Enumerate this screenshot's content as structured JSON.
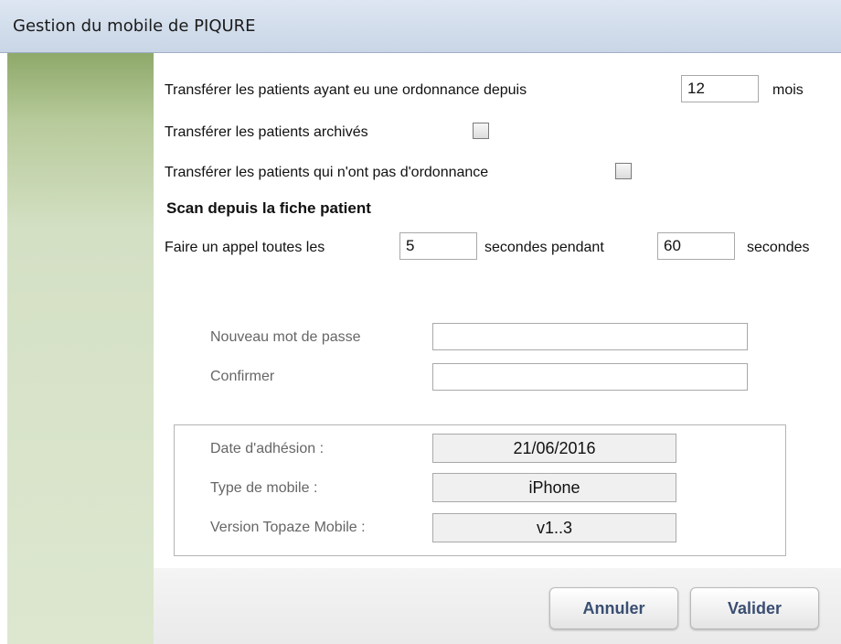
{
  "window": {
    "title": "Gestion du mobile de PIQURE"
  },
  "transfer": {
    "ordonnance_label": "Transférer les patients ayant eu une ordonnance depuis",
    "months_value": "12",
    "months_unit": "mois",
    "archived_label": "Transférer les patients archivés",
    "archived_checked": false,
    "no_ordonnance_label": "Transférer les patients qui n'ont pas d'ordonnance",
    "no_ordonnance_checked": false
  },
  "scan": {
    "heading": "Scan depuis la fiche patient",
    "call_label": "Faire un appel toutes les",
    "interval_value": "5",
    "during_label": "secondes pendant",
    "duration_value": "60",
    "seconds_label": "secondes"
  },
  "password": {
    "new_label": "Nouveau mot de passe",
    "new_value": "",
    "confirm_label": "Confirmer",
    "confirm_value": ""
  },
  "info": {
    "date_label": "Date d'adhésion :",
    "date_value": "21/06/2016",
    "type_label": "Type de mobile :",
    "type_value": "iPhone",
    "version_label": "Version Topaze Mobile :",
    "version_value": "v1..3"
  },
  "buttons": {
    "cancel": "Annuler",
    "submit": "Valider"
  },
  "colors": {
    "sidebar": "#b8cb9c",
    "titlebar": "#cfdbea",
    "button_text": "#3a4e72"
  }
}
